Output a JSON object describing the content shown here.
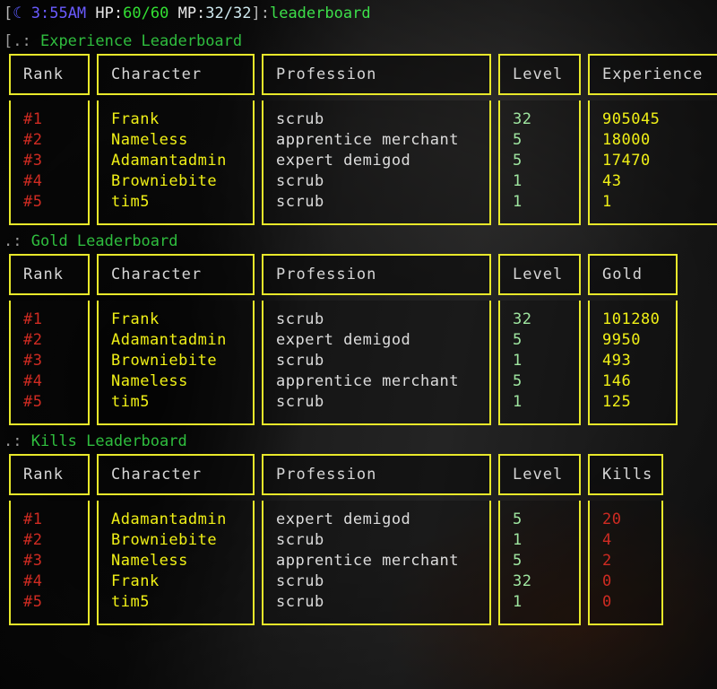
{
  "status_line": {
    "open_bracket": "[",
    "moon_icon": "☾",
    "time": "3:55AM",
    "hp_label": "HP:",
    "hp_value": "60/60",
    "mp_label": "MP:",
    "mp_value": "32/32",
    "close_bracket": "]:",
    "command": "leaderboard"
  },
  "colors": {
    "border_yellow": "#e8e82a",
    "header_text": "#d6d6d6",
    "rank_red": "#cf2b22",
    "character_yellow": "#f0f016",
    "profession_white": "#dcdcdc",
    "level_green": "#9fe6a0",
    "title_green": "#2fbe3e",
    "command_green": "#3ddf4a",
    "hp_green": "#33e033",
    "mp_cyan": "#cfe9ef",
    "moon_blue": "#5b5bff"
  },
  "boards": [
    {
      "title_prefix": "[.:",
      "title": "Experience Leaderboard",
      "columns": [
        "Rank",
        "Character",
        "Profession",
        "Level",
        "Experience"
      ],
      "rows": [
        {
          "rank": "#1",
          "character": "Frank",
          "profession": "scrub",
          "level": "32",
          "value": "905045"
        },
        {
          "rank": "#2",
          "character": "Nameless",
          "profession": "apprentice merchant",
          "level": "5",
          "value": "18000"
        },
        {
          "rank": "#3",
          "character": "Adamantadmin",
          "profession": "expert demigod",
          "level": "5",
          "value": "17470"
        },
        {
          "rank": "#4",
          "character": "Browniebite",
          "profession": "scrub",
          "level": "1",
          "value": "43"
        },
        {
          "rank": "#5",
          "character": "tim5",
          "profession": "scrub",
          "level": "1",
          "value": "1"
        }
      ]
    },
    {
      "title_prefix": ".:",
      "title": "Gold Leaderboard",
      "columns": [
        "Rank",
        "Character",
        "Profession",
        "Level",
        "Gold"
      ],
      "rows": [
        {
          "rank": "#1",
          "character": "Frank",
          "profession": "scrub",
          "level": "32",
          "value": "101280"
        },
        {
          "rank": "#2",
          "character": "Adamantadmin",
          "profession": "expert demigod",
          "level": "5",
          "value": "9950"
        },
        {
          "rank": "#3",
          "character": "Browniebite",
          "profession": "scrub",
          "level": "1",
          "value": "493"
        },
        {
          "rank": "#4",
          "character": "Nameless",
          "profession": "apprentice merchant",
          "level": "5",
          "value": "146"
        },
        {
          "rank": "#5",
          "character": "tim5",
          "profession": "scrub",
          "level": "1",
          "value": "125"
        }
      ]
    },
    {
      "title_prefix": ".:",
      "title": "Kills Leaderboard",
      "columns": [
        "Rank",
        "Character",
        "Profession",
        "Level",
        "Kills"
      ],
      "rows": [
        {
          "rank": "#1",
          "character": "Adamantadmin",
          "profession": "expert demigod",
          "level": "5",
          "value": "20"
        },
        {
          "rank": "#2",
          "character": "Browniebite",
          "profession": "scrub",
          "level": "1",
          "value": "4"
        },
        {
          "rank": "#3",
          "character": "Nameless",
          "profession": "apprentice merchant",
          "level": "5",
          "value": "2"
        },
        {
          "rank": "#4",
          "character": "Frank",
          "profession": "scrub",
          "level": "32",
          "value": "0"
        },
        {
          "rank": "#5",
          "character": "tim5",
          "profession": "scrub",
          "level": "1",
          "value": "0"
        }
      ]
    }
  ]
}
